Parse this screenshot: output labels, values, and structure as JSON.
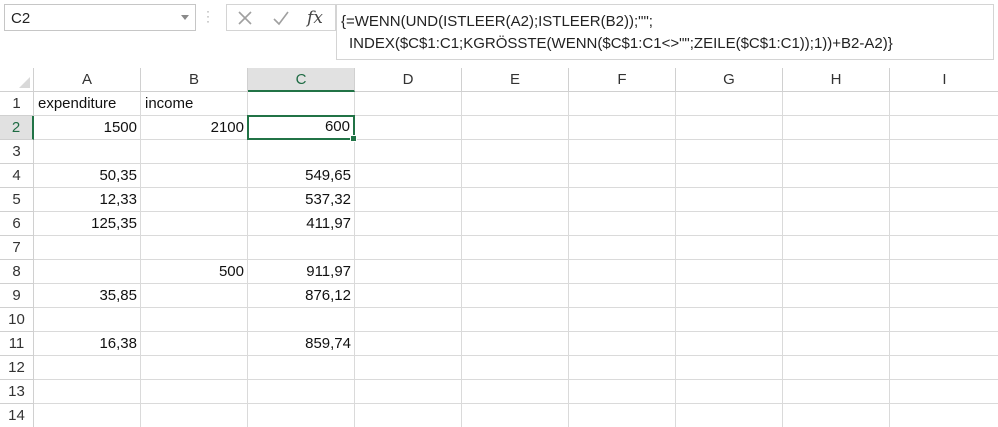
{
  "name_box": {
    "value": "C2"
  },
  "formula_bar": {
    "cancel_icon": "x-icon",
    "enter_icon": "check-icon",
    "fx_label": "fx",
    "formula_line1": "{=WENN(UND(ISTLEER(A2);ISTLEER(B2));\"\";",
    "formula_line2": "INDEX($C$1:C1;KGRÖSSTE(WENN($C$1:C1<>\"\";ZEILE($C$1:C1));1))+B2-A2)}"
  },
  "columns": [
    "A",
    "B",
    "C",
    "D",
    "E",
    "F",
    "G",
    "H",
    "I"
  ],
  "rows": [
    "1",
    "2",
    "3",
    "4",
    "5",
    "6",
    "7",
    "8",
    "9",
    "10",
    "11",
    "12",
    "13",
    "14"
  ],
  "selected": {
    "col": "C",
    "row": "2"
  },
  "cells": [
    [
      "expenditure",
      "income",
      ""
    ],
    [
      "1500",
      "2100",
      "600"
    ],
    [
      "",
      "",
      ""
    ],
    [
      "50,35",
      "",
      "549,65"
    ],
    [
      "12,33",
      "",
      "537,32"
    ],
    [
      "125,35",
      "",
      "411,97"
    ],
    [
      "",
      "",
      ""
    ],
    [
      "",
      "500",
      "911,97"
    ],
    [
      "35,85",
      "",
      "876,12"
    ],
    [
      "",
      "",
      ""
    ],
    [
      "16,38",
      "",
      "859,74"
    ],
    [
      "",
      "",
      ""
    ],
    [
      "",
      "",
      ""
    ],
    [
      "",
      "",
      ""
    ]
  ],
  "colors": {
    "accent": "#217346",
    "header_selected_bg": "#e1e1e1",
    "gridline": "#dadada"
  }
}
